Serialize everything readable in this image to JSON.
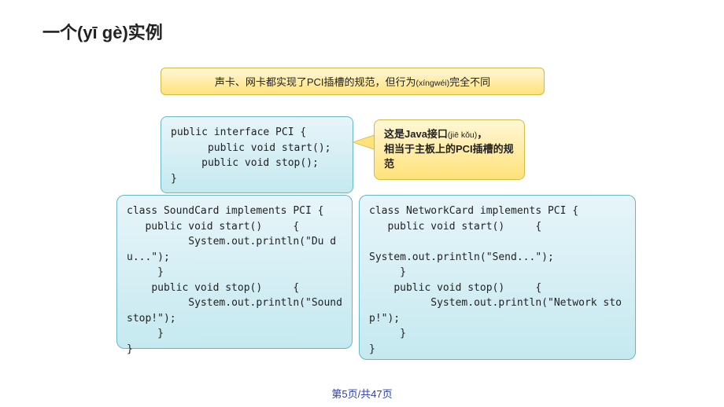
{
  "title": "一个(yī gè)实例",
  "banner": {
    "lead": "声卡、网卡都实现了PCI插槽的规范，但行为",
    "sub": "(xíngwéi)",
    "tail": "完全不同"
  },
  "iface": "public interface PCI {\n      public void start();\n     public void stop();\n}",
  "callout": {
    "l1a": "这是Java接口",
    "l1b": "(jiē kǒu)",
    "l1c": "，",
    "l2": "相当于主板上的PCI插槽的规范"
  },
  "code_left": "class SoundCard implements PCI {\n   public void start()     {\n          System.out.println(\"Du du...\");\n     }\n    public void stop()     {\n          System.out.println(\"Sound stop!\");\n     }\n}",
  "code_right": "class NetworkCard implements PCI {\n   public void start()     {\n\nSystem.out.println(\"Send...\");\n     }\n    public void stop()     {\n          System.out.println(\"Network stop!\");\n     }\n}",
  "pagenum": "第5页/共47页"
}
